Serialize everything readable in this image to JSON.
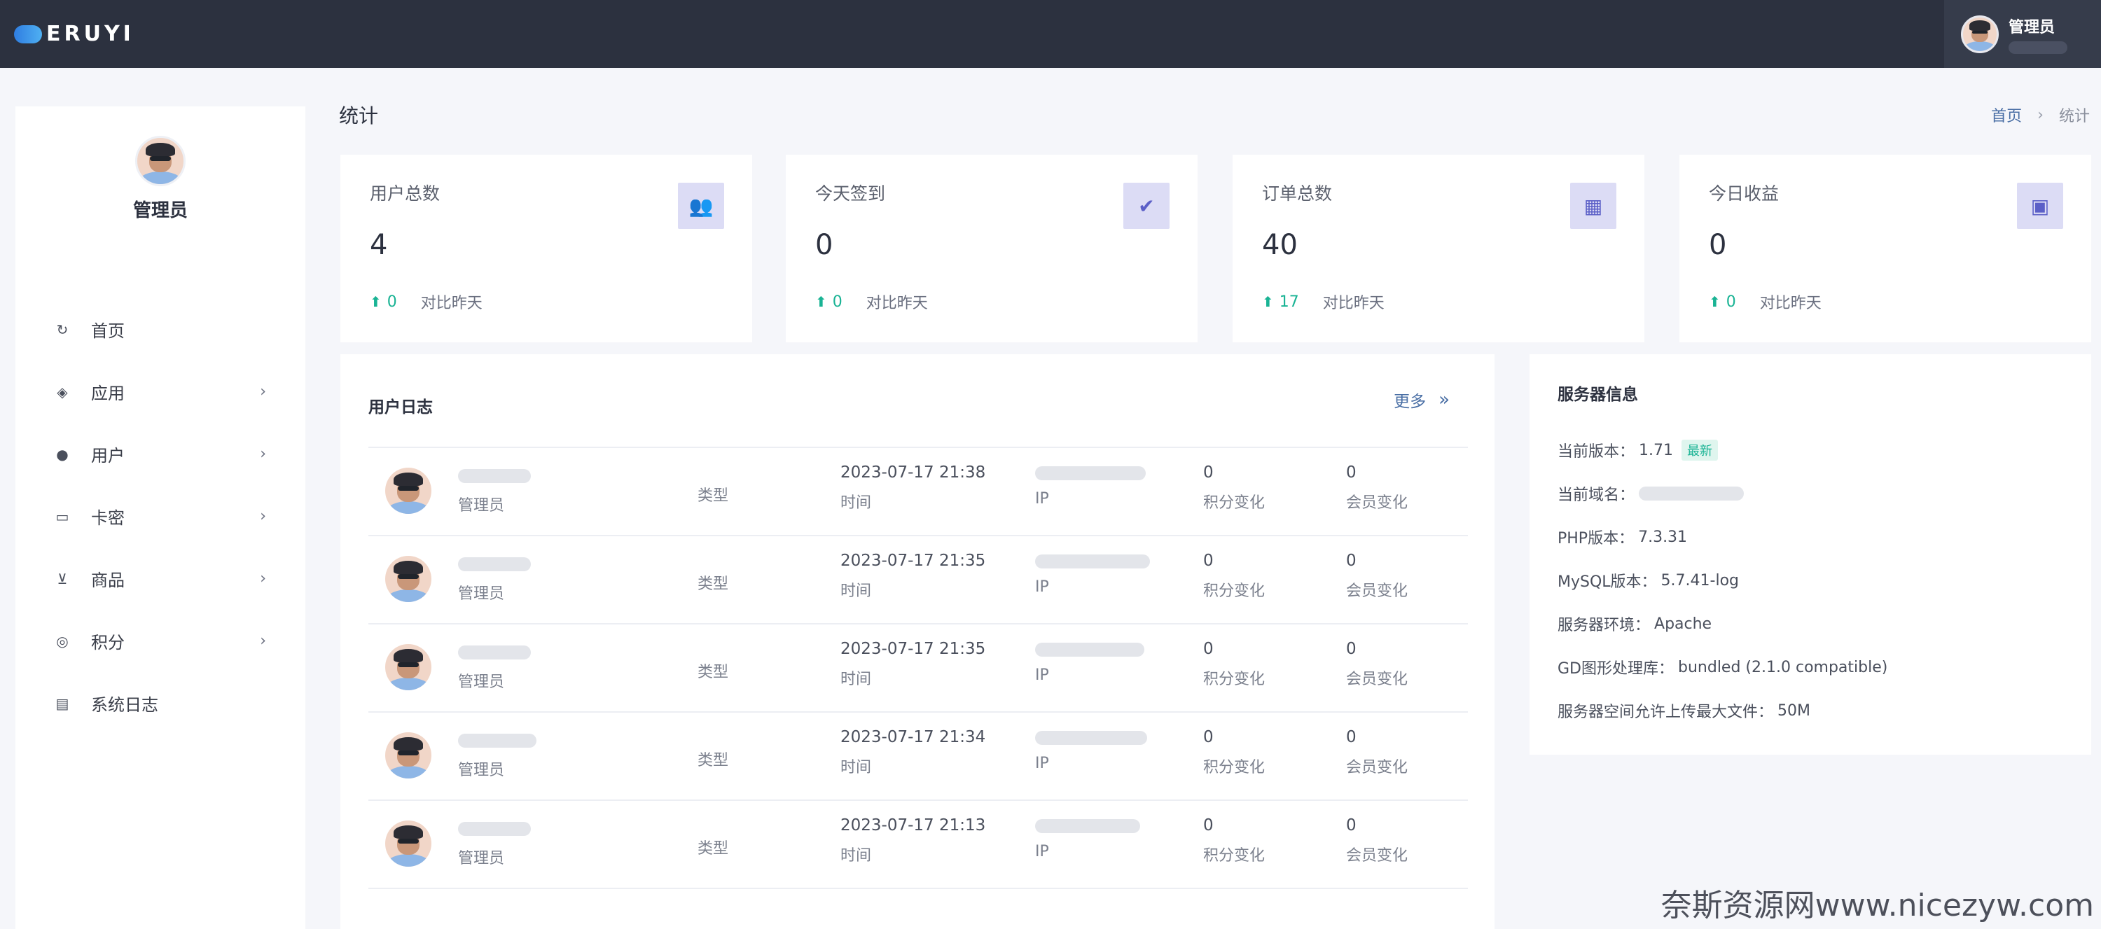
{
  "app": {
    "logo_text": "ERUYI"
  },
  "topbar": {
    "user_name": "管理员"
  },
  "sidebar": {
    "profile_name": "管理员",
    "items": [
      {
        "label": "首页",
        "icon": "refresh-icon",
        "glyph": "↻",
        "arrow": false
      },
      {
        "label": "应用",
        "icon": "cube-icon",
        "glyph": "◈",
        "arrow": true
      },
      {
        "label": "用户",
        "icon": "user-icon",
        "glyph": "●",
        "arrow": true
      },
      {
        "label": "卡密",
        "icon": "card-icon",
        "glyph": "▭",
        "arrow": true
      },
      {
        "label": "商品",
        "icon": "cart-icon",
        "glyph": "⊻",
        "arrow": true
      },
      {
        "label": "积分",
        "icon": "coin-icon",
        "glyph": "◎",
        "arrow": true
      },
      {
        "label": "系统日志",
        "icon": "log-icon",
        "glyph": "▤",
        "arrow": false
      }
    ]
  },
  "page": {
    "title": "统计"
  },
  "breadcrumb": {
    "home": "首页",
    "separator": "›",
    "current": "统计"
  },
  "stats": [
    {
      "title": "用户总数",
      "value": "4",
      "change": "0",
      "compare": "对比昨天",
      "icon": "users-icon",
      "glyph": "👥"
    },
    {
      "title": "今天签到",
      "value": "0",
      "change": "0",
      "compare": "对比昨天",
      "icon": "user-check-icon",
      "glyph": "✔"
    },
    {
      "title": "订单总数",
      "value": "40",
      "change": "17",
      "compare": "对比昨天",
      "icon": "calendar-icon",
      "glyph": "▦"
    },
    {
      "title": "今日收益",
      "value": "0",
      "change": "0",
      "compare": "对比昨天",
      "icon": "money-icon",
      "glyph": "▣"
    }
  ],
  "user_log": {
    "title": "用户日志",
    "more": "更多",
    "more_icon": "»",
    "rows": [
      {
        "role": "管理员",
        "type": "类型",
        "time": "2023-07-17 21:38",
        "time_label": "时间",
        "ip_label": "IP",
        "score": "0",
        "score_label": "积分变化",
        "member": "0",
        "member_label": "会员变化"
      },
      {
        "role": "管理员",
        "type": "类型",
        "time": "2023-07-17 21:35",
        "time_label": "时间",
        "ip_label": "IP",
        "score": "0",
        "score_label": "积分变化",
        "member": "0",
        "member_label": "会员变化"
      },
      {
        "role": "管理员",
        "type": "类型",
        "time": "2023-07-17 21:35",
        "time_label": "时间",
        "ip_label": "IP",
        "score": "0",
        "score_label": "积分变化",
        "member": "0",
        "member_label": "会员变化"
      },
      {
        "role": "管理员",
        "type": "类型",
        "time": "2023-07-17 21:34",
        "time_label": "时间",
        "ip_label": "IP",
        "score": "0",
        "score_label": "积分变化",
        "member": "0",
        "member_label": "会员变化"
      },
      {
        "role": "管理员",
        "type": "类型",
        "time": "2023-07-17 21:13",
        "time_label": "时间",
        "ip_label": "IP",
        "score": "0",
        "score_label": "积分变化",
        "member": "0",
        "member_label": "会员变化"
      }
    ]
  },
  "server": {
    "title": "服务器信息",
    "version_label": "当前版本：",
    "version": "1.71",
    "version_badge": "最新",
    "domain_label": "当前域名：",
    "php_label": "PHP版本：",
    "php": "7.3.31",
    "mysql_label": "MySQL版本：",
    "mysql": "5.7.41-log",
    "env_label": "服务器环境：",
    "env": "Apache",
    "gd_label": "GD图形处理库：",
    "gd": "bundled (2.1.0 compatible)",
    "upload_label": "服务器空间允许上传最大文件：",
    "upload": "50M"
  },
  "watermark": "奈斯资源网www.nicezyw.com",
  "colors": {
    "topbar": "#2c313f",
    "accent": "#19b394",
    "icon_bg": "#dcdcf5",
    "link": "#4a6fa5"
  }
}
